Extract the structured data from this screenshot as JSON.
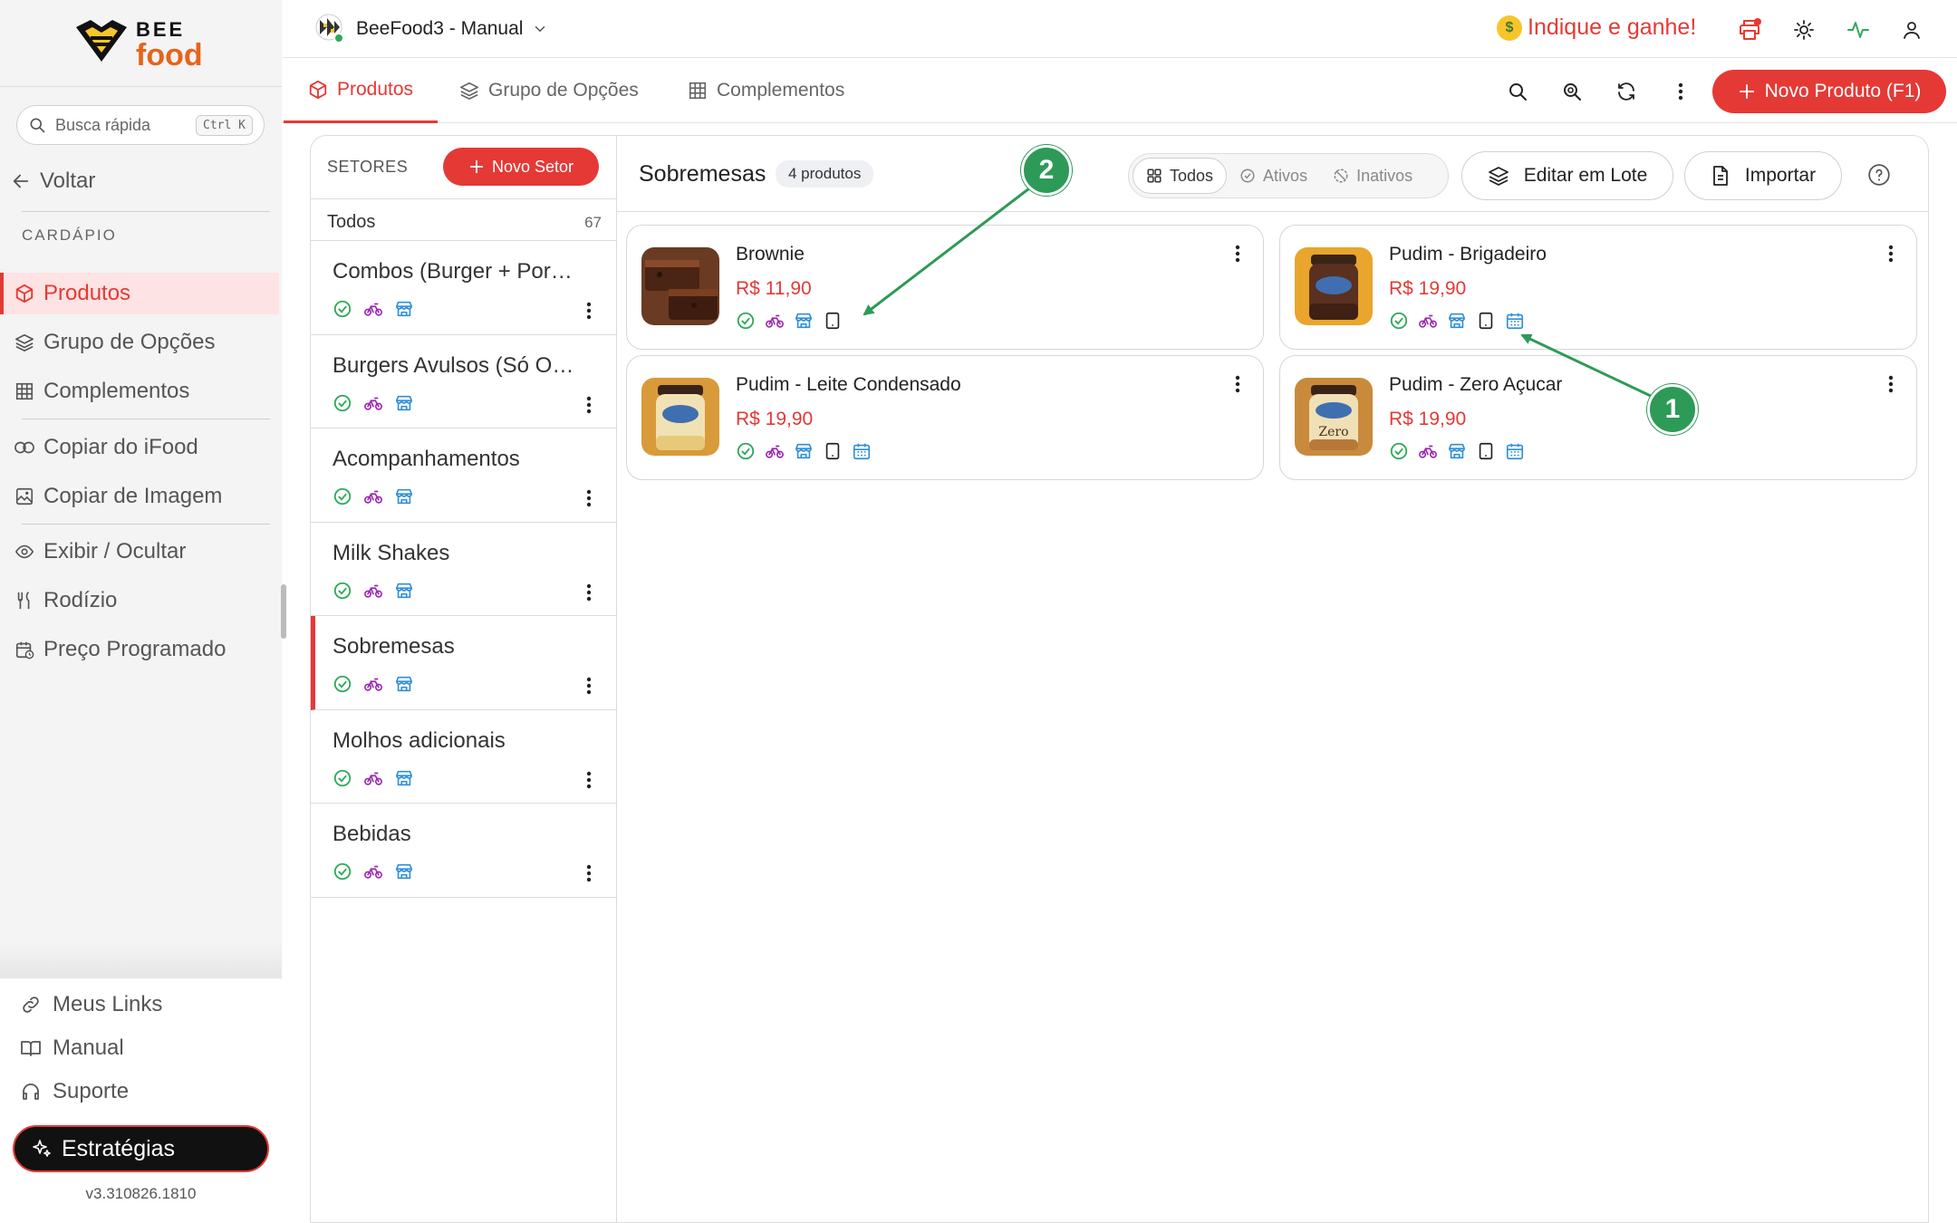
{
  "logo": {
    "line1": "BEE",
    "line2": "food"
  },
  "sidebar": {
    "search_placeholder": "Busca rápida",
    "search_shortcut": "Ctrl K",
    "back_label": "Voltar",
    "section_label": "CARDÁPIO",
    "items": [
      {
        "label": "Produtos",
        "icon": "box-icon"
      },
      {
        "label": "Grupo de Opções",
        "icon": "layers-icon"
      },
      {
        "label": "Complementos",
        "icon": "grid-icon"
      },
      {
        "label": "Copiar do iFood",
        "icon": "copy-icon"
      },
      {
        "label": "Copiar de Imagem",
        "icon": "image-copy-icon"
      },
      {
        "label": "Exibir / Ocultar",
        "icon": "eye-icon"
      },
      {
        "label": "Rodízio",
        "icon": "utensils-icon"
      },
      {
        "label": "Preço Programado",
        "icon": "calendar-clock-icon"
      }
    ],
    "footer": [
      {
        "label": "Meus Links",
        "icon": "link-icon"
      },
      {
        "label": "Manual",
        "icon": "book-icon"
      },
      {
        "label": "Suporte",
        "icon": "headset-icon"
      }
    ],
    "strategies_label": "Estratégias",
    "version": "v3.310826.1810"
  },
  "header": {
    "app_name": "BeeFood3 - Manual",
    "referral": "Indique e ganhe!"
  },
  "tabs": [
    {
      "label": "Produtos",
      "active": true
    },
    {
      "label": "Grupo de Opções",
      "active": false
    },
    {
      "label": "Complementos",
      "active": false
    }
  ],
  "new_product_label": "Novo Produto (F1)",
  "sectors": {
    "header_label": "SETORES",
    "new_sector_label": "Novo Setor",
    "all": {
      "label": "Todos",
      "count": "67"
    },
    "items": [
      {
        "label": "Combos (Burger + Porção)"
      },
      {
        "label": "Burgers Avulsos (Só O Burger)"
      },
      {
        "label": "Acompanhamentos"
      },
      {
        "label": "Milk Shakes"
      },
      {
        "label": "Sobremesas",
        "active": true
      },
      {
        "label": "Molhos adicionais"
      },
      {
        "label": "Bebidas"
      }
    ]
  },
  "main": {
    "title": "Sobremesas",
    "count_badge": "4 produtos",
    "filters": [
      {
        "label": "Todos",
        "active": true
      },
      {
        "label": "Ativos",
        "active": false
      },
      {
        "label": "Inativos",
        "active": false
      }
    ],
    "batch_edit_label": "Editar em Lote",
    "import_label": "Importar",
    "products": [
      {
        "name": "Brownie",
        "price": "R$ 11,90",
        "scheduled": false
      },
      {
        "name": "Pudim - Brigadeiro",
        "price": "R$ 19,90",
        "scheduled": true
      },
      {
        "name": "Pudim - Leite Condensado",
        "price": "R$ 19,90",
        "scheduled": true
      },
      {
        "name": "Pudim - Zero Açucar",
        "price": "R$ 19,90",
        "scheduled": true
      }
    ]
  },
  "annotations": [
    {
      "label": "1"
    },
    {
      "label": "2"
    }
  ],
  "colors": {
    "accent": "#e53935",
    "status_green": "#2eaa5a",
    "delivery_purple": "#9b27b0",
    "store_blue": "#2f8fd8",
    "annotation_green": "#2e9a57",
    "logo_orange": "#e8631c"
  }
}
